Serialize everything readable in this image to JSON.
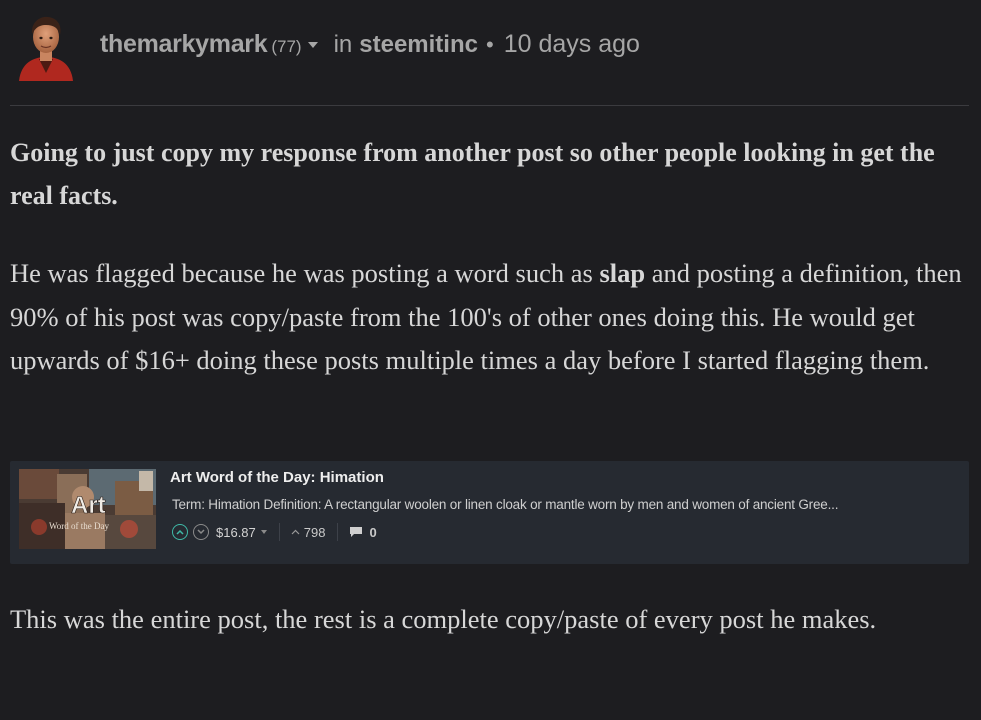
{
  "header": {
    "author": "themarkymark",
    "reputation": "(77)",
    "in_label": "in",
    "community": "steemitinc",
    "separator": "•",
    "timestamp": "10 days ago"
  },
  "post": {
    "paragraph1": "Going to just copy my response from another post so other people looking in get the real facts.",
    "paragraph2_before": "He was flagged because he was posting a word such as ",
    "paragraph2_bold": "slap",
    "paragraph2_after": " and posting a definition, then 90% of his post was copy/paste from the 100's of other ones doing this. He would get upwards of $16+ doing these posts multiple times a day before I started flagging them.",
    "paragraph3": "This was the entire post, the rest is a complete copy/paste of every post he makes."
  },
  "embed_card": {
    "thumbnail_text": "Art",
    "thumbnail_subtext": "Word of the Day",
    "title": "Art Word of the Day: Himation",
    "description": "Term: Himation Definition: A rectangular woolen or linen cloak or mantle worn by men and women of ancient Gree...",
    "payout": "$16.87",
    "votes": "798",
    "comments": "0"
  },
  "colors": {
    "background": "#1d1d20",
    "card_background": "#262a31",
    "upvote_accent": "#3fb9a7",
    "muted_text": "#a6a6a6"
  }
}
